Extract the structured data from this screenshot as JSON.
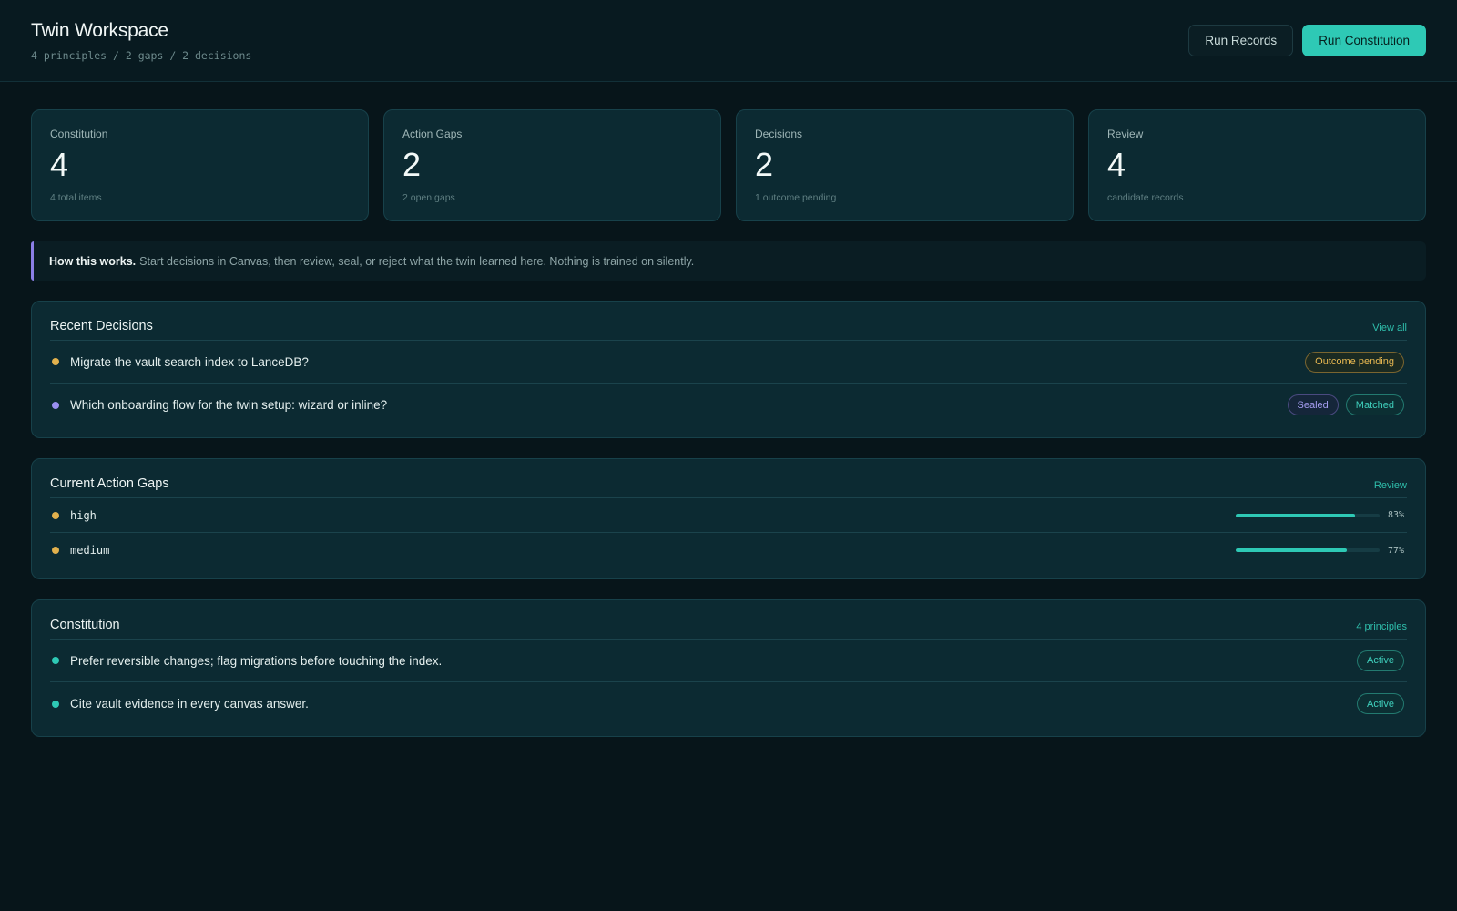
{
  "header": {
    "title": "Twin Workspace",
    "subtitle": "4 principles / 2 gaps / 2 decisions",
    "run_records_label": "Run Records",
    "run_constitution_label": "Run Constitution"
  },
  "stats": [
    {
      "label": "Constitution",
      "value": "4",
      "sub": "4 total items"
    },
    {
      "label": "Action Gaps",
      "value": "2",
      "sub": "2 open gaps"
    },
    {
      "label": "Decisions",
      "value": "2",
      "sub": "1 outcome pending"
    },
    {
      "label": "Review",
      "value": "4",
      "sub": "candidate records"
    }
  ],
  "info": {
    "strong": "How this works.",
    "text": "Start decisions in Canvas, then review, seal, or reject what the twin learned here. Nothing is trained on silently."
  },
  "recent_decisions": {
    "title": "Recent Decisions",
    "link": "View all",
    "items": [
      {
        "text": "Migrate the vault search index to LanceDB?",
        "dot_color": "#e2b14d",
        "tags": [
          "Outcome pending"
        ]
      },
      {
        "text": "Which onboarding flow for the twin setup: wizard or inline?",
        "dot_color": "#9a8ff0",
        "tags": [
          "Sealed",
          "Matched"
        ]
      }
    ]
  },
  "action_gaps": {
    "title": "Current Action Gaps",
    "link": "Review",
    "items": [
      {
        "label": "high",
        "dot_color": "#e2b14d",
        "percent": 83,
        "percent_label": "83%"
      },
      {
        "label": "medium",
        "dot_color": "#e2b14d",
        "percent": 77,
        "percent_label": "77%"
      }
    ]
  },
  "constitution": {
    "title": "Constitution",
    "link": "4 principles",
    "items": [
      {
        "text": "Prefer reversible changes; flag migrations before touching the index.",
        "dot_color": "#2ec9b5",
        "tag": "Active"
      },
      {
        "text": "Cite vault evidence in every canvas answer.",
        "dot_color": "#2ec9b5",
        "tag": "Active"
      }
    ]
  },
  "colors": {
    "accent": "#2ec9b5",
    "amber": "#e2b14d",
    "violet": "#9a8ff0",
    "background": "#07151a",
    "card": "#0c2a32"
  }
}
